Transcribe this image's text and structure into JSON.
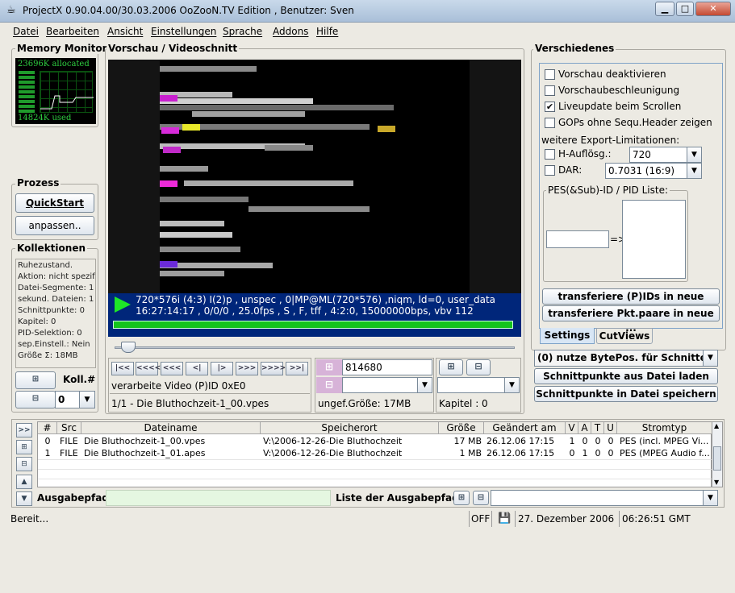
{
  "window": {
    "title": "ProjectX 0.90.04.00/30.03.2006 OoZooN.TV Edition , Benutzer: Sven",
    "minimize": "▁",
    "maximize": "□",
    "close": "✕"
  },
  "menu": [
    "Datei",
    "Bearbeiten",
    "Ansicht",
    "Einstellungen",
    "Sprache",
    "Addons",
    "Hilfe"
  ],
  "memory": {
    "title": "Memory Monitor",
    "allocated": "23696K allocated",
    "used": "14824K used"
  },
  "preview": {
    "title": "Vorschau / Videoschnitt",
    "info_line1": "720*576i (4:3) I(2)p , unspec , 0|MP@ML(720*576) ,niqm, ld=0, user_data",
    "info_line2": "16:27:14:17 , 0/0/0 , 25.0fps , S , F, tff , 4:2:0, 15000000bps, vbv 112",
    "position_value": "814680",
    "status_text": "verarbeite Video (P)ID 0xE0",
    "file_text": "1/1 - Die Bluthochzeit-1_00.vpes",
    "size_text": "ungef.Größe: 17MB",
    "chapter_text": "Kapitel :  0",
    "nav_icons": [
      "|<<",
      "<<<<",
      "<<<",
      "<|",
      "|>",
      ">>>",
      ">>>>",
      ">>|"
    ]
  },
  "prozess": {
    "title": "Prozess",
    "quickstart": "QuickStart",
    "anpassen": "anpassen.."
  },
  "kollektionen": {
    "title": "Kollektionen",
    "status": [
      "Ruhezustand.",
      "Aktion: nicht spezif.",
      "Datei-Segmente: 1",
      "sekund. Dateien: 1",
      "Schnittpunkte: 0",
      "Kapitel: 0",
      "PID-Selektion: 0",
      "sep.Einstell.: Nein",
      "Größe Σ: 18MB"
    ],
    "koll_label": "Koll.#",
    "koll_value": "0"
  },
  "verschiedenes": {
    "title": "Verschiedenes",
    "checks": [
      {
        "label": "Vorschau deaktivieren",
        "checked": false
      },
      {
        "label": "Vorschaubeschleunigung",
        "checked": false
      },
      {
        "label": "Liveupdate beim Scrollen",
        "checked": true
      },
      {
        "label": "GOPs ohne Sequ.Header zeigen",
        "checked": false
      }
    ],
    "export_title": "weitere Export-Limitationen:",
    "haufloesg_label": "H-Auflösg.:",
    "haufloesg_value": "720",
    "dar_label": "DAR:",
    "dar_value": "0.7031 (16:9)",
    "pid_title": "PES(&Sub)-ID / PID Liste:",
    "arrow": "=>",
    "transfer_ids": "transferiere (P)IDs in neue Koll.#",
    "transfer_pairs": "transferiere Pkt.paare in neue ...",
    "tabs": [
      "Settings",
      "CutViews"
    ],
    "bytepos": "(0) nutze BytePos. für Schnitte",
    "load_cuts": "Schnittpunkte aus Datei laden",
    "save_cuts": "Schnittpunkte in Datei speichern"
  },
  "files": {
    "headers": [
      "#",
      "Src",
      "Dateiname",
      "Speicherort",
      "Größe",
      "Geändert am",
      "V",
      "A",
      "T",
      "U",
      "Stromtyp"
    ],
    "rows": [
      [
        "0",
        "FILE",
        "Die Bluthochzeit-1_00.vpes",
        "V:\\2006-12-26-Die Bluthochzeit",
        "17 MB",
        "26.12.06  17:15",
        "1",
        "0",
        "0",
        "0",
        "PES (incl. MPEG Vi..."
      ],
      [
        "1",
        "FILE",
        "Die Bluthochzeit-1_01.apes",
        "V:\\2006-12-26-Die Bluthochzeit",
        "1 MB",
        "26.12.06  17:15",
        "0",
        "1",
        "0",
        "0",
        "PES (MPEG Audio f..."
      ]
    ],
    "ausgabepfad_label": "Ausgabepfad:",
    "liste_label": "Liste der Ausgabepfade:"
  },
  "statusbar": {
    "message": "Bereit...",
    "off": "OFF",
    "date": "27. Dezember 2006",
    "time": "06:26:51 GMT"
  }
}
